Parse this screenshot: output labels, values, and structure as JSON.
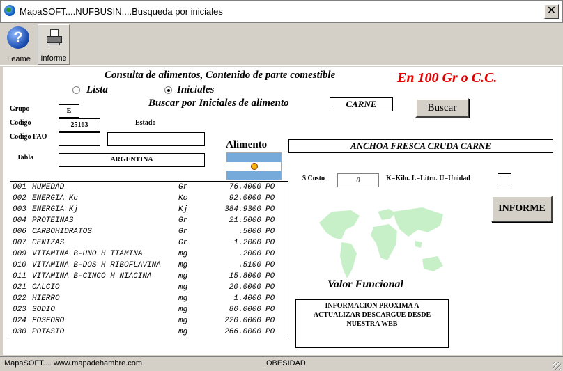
{
  "window": {
    "title": "MapaSOFT....NUFBUSIN....Busqueda por iniciales",
    "close_glyph": "✕",
    "icon": "globe-icon"
  },
  "toolbar": {
    "leame_label": "Leame",
    "informe_label": "Informe",
    "leame_icon": "help-icon",
    "informe_icon": "printer-icon"
  },
  "form": {
    "heading": "Consulta de alimentos, Contenido de parte comestible",
    "per100": "En 100 Gr  o C.C.",
    "radio_lista": "Lista",
    "radio_iniciales": "Iniciales",
    "selected_radio": "Iniciales",
    "search_label": "Buscar por Iniciales de alimento",
    "search_value": "CARNE",
    "buscar_button": "Buscar",
    "grupo_label": "Grupo",
    "grupo_value": "E",
    "codigo_label": "Codigo",
    "codigo_value": "25163",
    "estado_label": "Estado",
    "estado_value": "",
    "codigo_fao_label": "Codigo FAO",
    "codigo_fao_value": "",
    "tabla_label": "Tabla",
    "tabla_value": "ARGENTINA",
    "alimento_label": "Alimento",
    "alimento_value": "ANCHOA  FRESCA  CRUDA  CARNE",
    "costo_label": "$ Costo",
    "costo_value": "0",
    "units_label": "K=Kilo. L=Litro. U=Unidad",
    "unit_value": "",
    "informe_button": "INFORME",
    "valor_funcional": "Valor Funcional",
    "info_lines": [
      "INFORMACION PROXIMA A",
      "ACTUALIZAR  DESCARGUE DESDE",
      "NUESTRA WEB"
    ]
  },
  "nutrients": [
    {
      "code": "001",
      "name": "HUMEDAD",
      "unit": "Gr",
      "value": "76.4000",
      "src": "PO"
    },
    {
      "code": "002",
      "name": "ENERGIA Kc",
      "unit": "Kc",
      "value": "92.0000",
      "src": "PO"
    },
    {
      "code": "003",
      "name": "ENERGIA Kj",
      "unit": "Kj",
      "value": "384.9300",
      "src": "PO"
    },
    {
      "code": "004",
      "name": "PROTEINAS",
      "unit": "Gr",
      "value": "21.5000",
      "src": "PO"
    },
    {
      "code": "006",
      "name": "CARBOHIDRATOS",
      "unit": "Gr",
      "value": ".5000",
      "src": "PO"
    },
    {
      "code": "007",
      "name": "CENIZAS",
      "unit": "Gr",
      "value": "1.2000",
      "src": "PO"
    },
    {
      "code": "009",
      "name": "VITAMINA B-UNO H TIAMINA",
      "unit": "mg",
      "value": ".2000",
      "src": "PO"
    },
    {
      "code": "010",
      "name": "VITAMINA B-DOS H RIBOFLAVINA",
      "unit": "mg",
      "value": ".5100",
      "src": "PO"
    },
    {
      "code": "011",
      "name": "VITAMINA B-CINCO H NIACINA",
      "unit": "mg",
      "value": "15.8000",
      "src": "PO"
    },
    {
      "code": "021",
      "name": "CALCIO",
      "unit": "mg",
      "value": "20.0000",
      "src": "PO"
    },
    {
      "code": "022",
      "name": "HIERRO",
      "unit": "mg",
      "value": "1.4000",
      "src": "PO"
    },
    {
      "code": "023",
      "name": "SODIO",
      "unit": "mg",
      "value": "80.0000",
      "src": "PO"
    },
    {
      "code": "024",
      "name": "FOSFORO",
      "unit": "mg",
      "value": "220.0000",
      "src": "PO"
    },
    {
      "code": "030",
      "name": "POTASIO",
      "unit": "mg",
      "value": "266.0000",
      "src": "PO"
    }
  ],
  "status": {
    "left": "MapaSOFT.... www.mapadehambre.com",
    "middle": "OBESIDAD"
  },
  "colors": {
    "accent_red": "#e00000",
    "map_green": "#c8f0c8",
    "flag_blue": "#75aadb"
  }
}
